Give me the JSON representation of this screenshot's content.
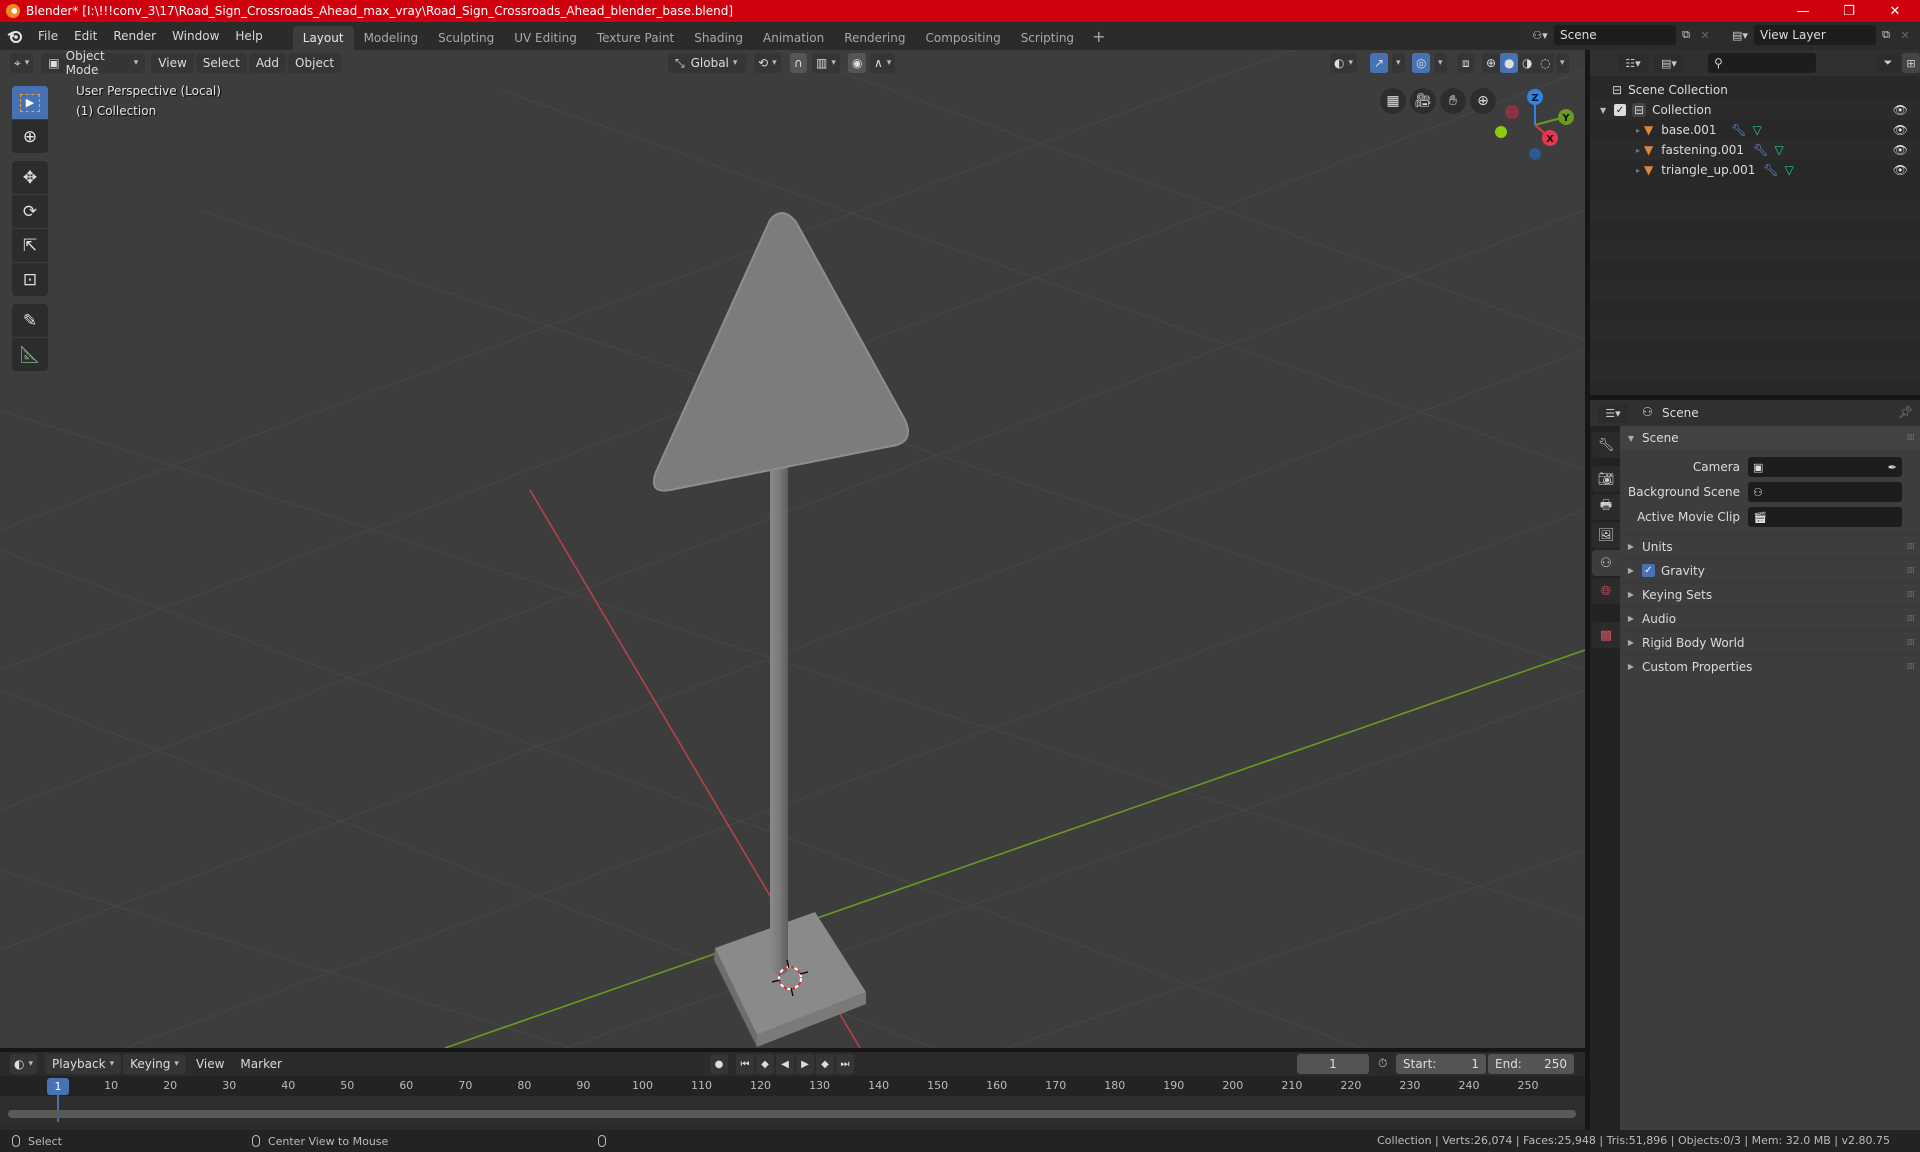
{
  "window": {
    "title": "Blender* [I:\\!!!conv_3\\17\\Road_Sign_Crossroads_Ahead_max_vray\\Road_Sign_Crossroads_Ahead_blender_base.blend]",
    "minimize": "—",
    "maximize": "❐",
    "close": "✕"
  },
  "menubar": {
    "menus": [
      "File",
      "Edit",
      "Render",
      "Window",
      "Help"
    ],
    "workspaces": [
      "Layout",
      "Modeling",
      "Sculpting",
      "UV Editing",
      "Texture Paint",
      "Shading",
      "Animation",
      "Rendering",
      "Compositing",
      "Scripting"
    ],
    "active_workspace": "Layout",
    "add_workspace": "+",
    "scene": "Scene",
    "view_layer": "View Layer"
  },
  "viewport": {
    "mode": "Object Mode",
    "menus": [
      "View",
      "Select",
      "Add",
      "Object"
    ],
    "orientation": "Global",
    "perspective_label": "User Perspective (Local)",
    "collection_label": "(1) Collection",
    "gizmo": {
      "z": "Z",
      "y": "Y",
      "x": "X"
    },
    "colors": {
      "background": "#3d3d3d",
      "x_axis": "#c8404c",
      "y_axis": "#6c9a22",
      "object": "#7d7d7d",
      "accent": "#4772b3"
    }
  },
  "outliner": {
    "search_placeholder": "",
    "root": "Scene Collection",
    "collection": "Collection",
    "objects": [
      {
        "name": "base.001"
      },
      {
        "name": "fastening.001"
      },
      {
        "name": "triangle_up.001"
      }
    ]
  },
  "properties": {
    "context": "Scene",
    "panel_title": "Scene",
    "fields": [
      {
        "label": "Camera",
        "value": ""
      },
      {
        "label": "Background Scene",
        "value": ""
      },
      {
        "label": "Active Movie Clip",
        "value": ""
      }
    ],
    "subpanels": [
      "Units",
      "Gravity",
      "Keying Sets",
      "Audio",
      "Rigid Body World",
      "Custom Properties"
    ],
    "gravity_enabled": true
  },
  "timeline": {
    "menus": [
      "Playback",
      "Keying",
      "View",
      "Marker"
    ],
    "current_frame": "1",
    "start_label": "Start:",
    "start": "1",
    "end_label": "End:",
    "end": "250",
    "ticks": [
      "10",
      "20",
      "30",
      "40",
      "50",
      "60",
      "70",
      "80",
      "90",
      "100",
      "110",
      "120",
      "130",
      "140",
      "150",
      "160",
      "170",
      "180",
      "190",
      "200",
      "210",
      "220",
      "230",
      "240",
      "250"
    ]
  },
  "statusbar": {
    "left_action": "Select",
    "middle_action": "Center View to Mouse",
    "stats": "Collection | Verts:26,074 | Faces:25,948 | Tris:51,896 | Objects:0/3 | Mem: 32.0 MB | v2.80.75"
  }
}
